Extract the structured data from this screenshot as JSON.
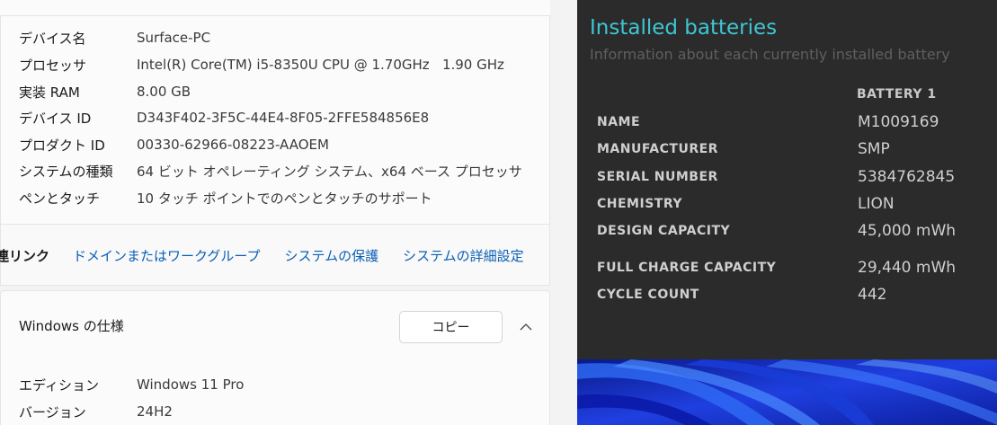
{
  "settings": {
    "device_specs": [
      {
        "label": "デバイス名",
        "value": "Surface-PC"
      },
      {
        "label": "プロセッサ",
        "value": "Intel(R) Core(TM) i5-8350U CPU @ 1.70GHz   1.90 GHz"
      },
      {
        "label": "実装 RAM",
        "value": "8.00 GB"
      },
      {
        "label": "デバイス ID",
        "value": "D343F402-3F5C-44E4-8F05-2FFE584856E8"
      },
      {
        "label": "プロダクト ID",
        "value": "00330-62966-08223-AAOEM"
      },
      {
        "label": "システムの種類",
        "value": "64 ビット オペレーティング システム、x64 ベース プロセッサ"
      },
      {
        "label": "ペンとタッチ",
        "value": "10 タッチ ポイントでのペンとタッチのサポート"
      }
    ],
    "related_links": {
      "title": "連リンク",
      "links": [
        "ドメインまたはワークグループ",
        "システムの保護",
        "システムの詳細設定"
      ]
    },
    "windows_spec": {
      "title": "Windows の仕様",
      "copy_label": "コピー",
      "rows": [
        {
          "label": "エディション",
          "value": "Windows 11 Pro"
        },
        {
          "label": "バージョン",
          "value": "24H2"
        }
      ]
    }
  },
  "battery_report": {
    "title": "Installed batteries",
    "subtitle": "Information about each currently installed battery",
    "column_header": "BATTERY 1",
    "rows": [
      {
        "label": "NAME",
        "value": "M1009169"
      },
      {
        "label": "MANUFACTURER",
        "value": "SMP"
      },
      {
        "label": "SERIAL NUMBER",
        "value": "5384762845"
      },
      {
        "label": "CHEMISTRY",
        "value": "LION"
      },
      {
        "label": "DESIGN CAPACITY",
        "value": "45,000 mWh"
      },
      {
        "label": "FULL CHARGE CAPACITY",
        "value": "29,440 mWh"
      },
      {
        "label": "CYCLE COUNT",
        "value": "442"
      }
    ]
  },
  "colors": {
    "link": "#0a5fb4",
    "report_title": "#3fc6d4",
    "report_background": "#2b2b2b",
    "wallpaper_blue": "#1f3fe0"
  },
  "icons": {
    "collapse": "chevron-up-icon"
  }
}
